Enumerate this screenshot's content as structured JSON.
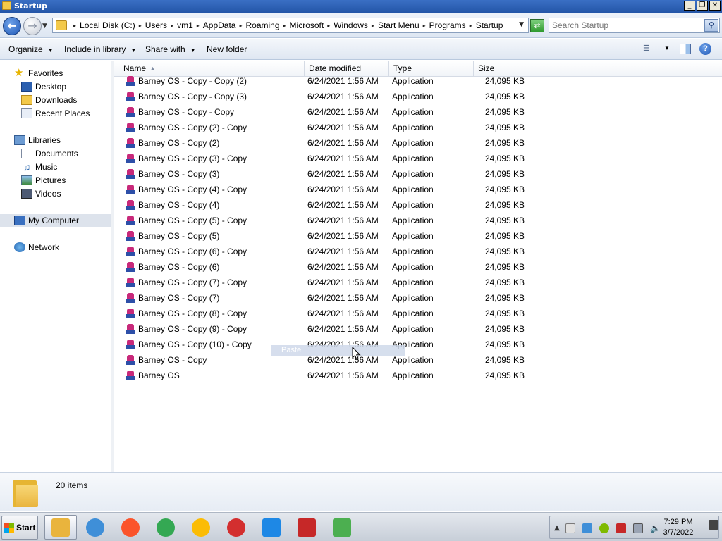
{
  "window": {
    "title": "Startup",
    "controls": {
      "minimize": "_",
      "maximize": "❐",
      "close": "✕"
    }
  },
  "address": {
    "crumbs": [
      "Local Disk (C:)",
      "Users",
      "vm1",
      "AppData",
      "Roaming",
      "Microsoft",
      "Windows",
      "Start Menu",
      "Programs",
      "Startup"
    ],
    "search_placeholder": "Search Startup"
  },
  "toolbar": {
    "organize": "Organize",
    "include_in_library": "Include in library",
    "share_with": "Share with",
    "new_folder": "New folder",
    "help": "?"
  },
  "nav": {
    "favorites": "Favorites",
    "desktop": "Desktop",
    "downloads": "Downloads",
    "recent_places": "Recent Places",
    "libraries": "Libraries",
    "documents": "Documents",
    "music": "Music",
    "pictures": "Pictures",
    "videos": "Videos",
    "my_computer": "My Computer",
    "network": "Network"
  },
  "columns": {
    "name": "Name",
    "date": "Date modified",
    "type": "Type",
    "size": "Size"
  },
  "files": [
    {
      "name": "Barney OS - Copy - Copy (2)",
      "date": "6/24/2021 1:56 AM",
      "type": "Application",
      "size": "24,095 KB"
    },
    {
      "name": "Barney OS - Copy - Copy (3)",
      "date": "6/24/2021 1:56 AM",
      "type": "Application",
      "size": "24,095 KB"
    },
    {
      "name": "Barney OS - Copy - Copy",
      "date": "6/24/2021 1:56 AM",
      "type": "Application",
      "size": "24,095 KB"
    },
    {
      "name": "Barney OS - Copy (2) - Copy",
      "date": "6/24/2021 1:56 AM",
      "type": "Application",
      "size": "24,095 KB"
    },
    {
      "name": "Barney OS - Copy (2)",
      "date": "6/24/2021 1:56 AM",
      "type": "Application",
      "size": "24,095 KB"
    },
    {
      "name": "Barney OS - Copy (3) - Copy",
      "date": "6/24/2021 1:56 AM",
      "type": "Application",
      "size": "24,095 KB"
    },
    {
      "name": "Barney OS - Copy (3)",
      "date": "6/24/2021 1:56 AM",
      "type": "Application",
      "size": "24,095 KB"
    },
    {
      "name": "Barney OS - Copy (4) - Copy",
      "date": "6/24/2021 1:56 AM",
      "type": "Application",
      "size": "24,095 KB"
    },
    {
      "name": "Barney OS - Copy (4)",
      "date": "6/24/2021 1:56 AM",
      "type": "Application",
      "size": "24,095 KB"
    },
    {
      "name": "Barney OS - Copy (5) - Copy",
      "date": "6/24/2021 1:56 AM",
      "type": "Application",
      "size": "24,095 KB"
    },
    {
      "name": "Barney OS - Copy (5)",
      "date": "6/24/2021 1:56 AM",
      "type": "Application",
      "size": "24,095 KB"
    },
    {
      "name": "Barney OS - Copy (6) - Copy",
      "date": "6/24/2021 1:56 AM",
      "type": "Application",
      "size": "24,095 KB"
    },
    {
      "name": "Barney OS - Copy (6)",
      "date": "6/24/2021 1:56 AM",
      "type": "Application",
      "size": "24,095 KB"
    },
    {
      "name": "Barney OS - Copy (7) - Copy",
      "date": "6/24/2021 1:56 AM",
      "type": "Application",
      "size": "24,095 KB"
    },
    {
      "name": "Barney OS - Copy (7)",
      "date": "6/24/2021 1:56 AM",
      "type": "Application",
      "size": "24,095 KB"
    },
    {
      "name": "Barney OS - Copy (8) - Copy",
      "date": "6/24/2021 1:56 AM",
      "type": "Application",
      "size": "24,095 KB"
    },
    {
      "name": "Barney OS - Copy (9) - Copy",
      "date": "6/24/2021 1:56 AM",
      "type": "Application",
      "size": "24,095 KB"
    },
    {
      "name": "Barney OS - Copy (10) - Copy",
      "date": "6/24/2021 1:56 AM",
      "type": "Application",
      "size": "24,095 KB"
    },
    {
      "name": "Barney OS - Copy",
      "date": "6/24/2021 1:56 AM",
      "type": "Application",
      "size": "24,095 KB"
    },
    {
      "name": "Barney OS",
      "date": "6/24/2021 1:56 AM",
      "type": "Application",
      "size": "24,095 KB"
    }
  ],
  "drag_hint": "Paste",
  "details": {
    "item_count": "20 items"
  },
  "taskbar": {
    "start": "Start",
    "apps": [
      {
        "icon": "explorer-icon",
        "color": "#e9b43d"
      },
      {
        "icon": "media-player-icon",
        "color": "#3f8fd8"
      },
      {
        "icon": "brave-icon",
        "color": "#fb542b"
      },
      {
        "icon": "chrome-icon",
        "color": "#34a853"
      },
      {
        "icon": "chrome-icon",
        "color": "#fbbc05"
      },
      {
        "icon": "antivirus-icon",
        "color": "#d32f2f"
      },
      {
        "icon": "vpn-shield-icon",
        "color": "#1e88e5"
      },
      {
        "icon": "screen-recorder-icon",
        "color": "#c62828"
      },
      {
        "icon": "task-manager-icon",
        "color": "#4caf50"
      }
    ],
    "time": "7:29 PM",
    "date": "3/7/2022"
  },
  "colors": {
    "title_bar": "#2456a8",
    "selection": "#dde3ec",
    "folder": "#f3c94a"
  }
}
